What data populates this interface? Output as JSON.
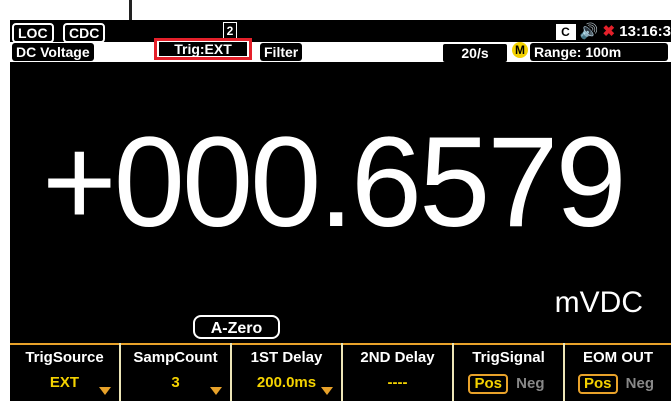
{
  "status": {
    "badges": [
      "LOC",
      "CDC"
    ],
    "page_indicator": "2",
    "icons": [
      "cdc-icon",
      "speaker-icon",
      "network-disconnected-icon"
    ],
    "time": "13:16:3"
  },
  "info": {
    "mode": "DC Voltage",
    "trigger": "Trig:EXT",
    "filter": "Filter",
    "rate": "20/s",
    "range_badge": "M",
    "range": "Range: 100m"
  },
  "reading": {
    "value": "+000.6579",
    "unit": "mVDC",
    "azero": "A-Zero"
  },
  "softkeys": [
    {
      "label": "TrigSource",
      "value": "EXT"
    },
    {
      "label": "SampCount",
      "value": "3"
    },
    {
      "label": "1ST Delay",
      "value": "200.0ms"
    },
    {
      "label": "2ND Delay",
      "value": "----"
    },
    {
      "label": "TrigSignal",
      "options": [
        "Pos",
        "Neg"
      ],
      "selected": "Pos"
    },
    {
      "label": "EOM OUT",
      "options": [
        "Pos",
        "Neg"
      ],
      "selected": "Pos"
    }
  ]
}
